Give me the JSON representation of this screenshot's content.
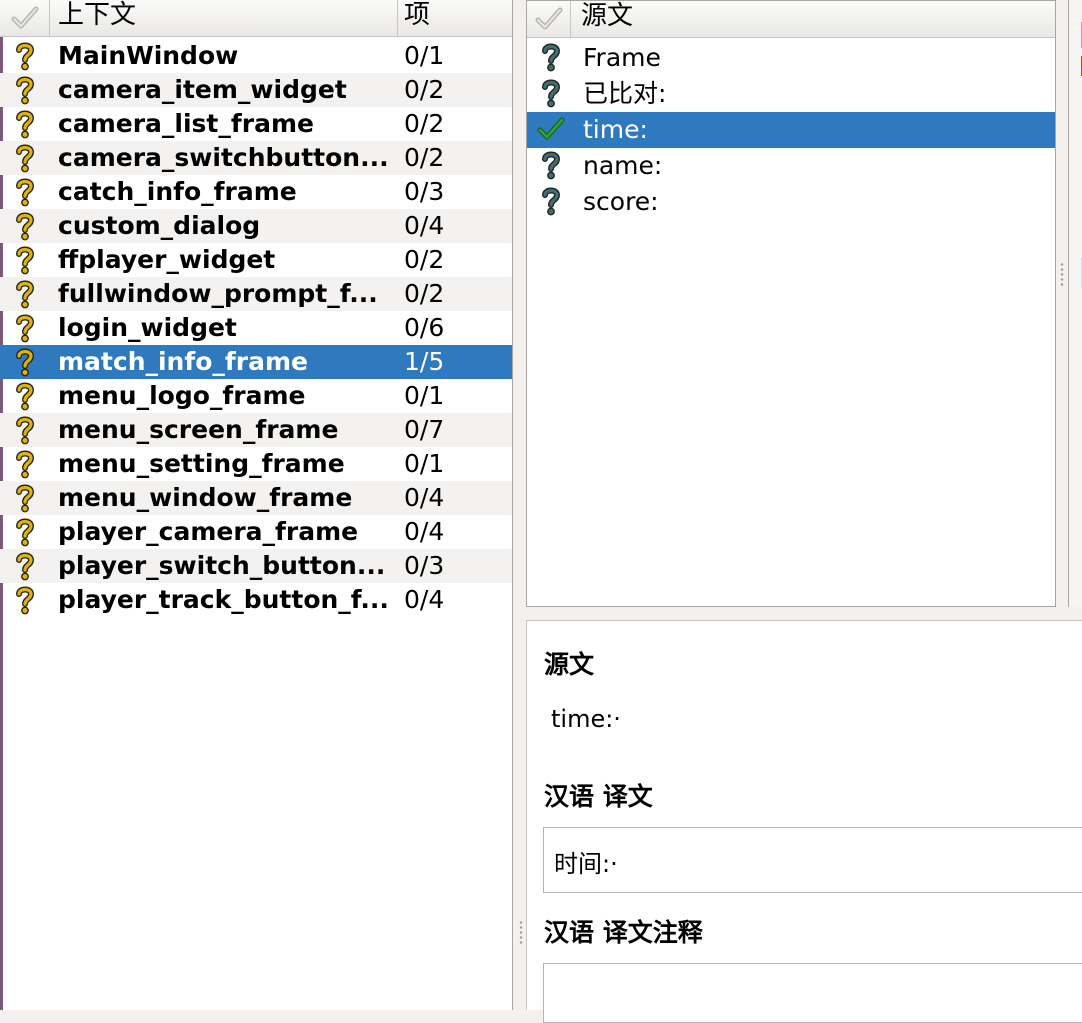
{
  "context_pane": {
    "header": {
      "context_label": "上下文",
      "items_label": "项"
    },
    "rows": [
      {
        "name": "MainWindow",
        "count": "0/1"
      },
      {
        "name": "camera_item_widget",
        "count": "0/2"
      },
      {
        "name": "camera_list_frame",
        "count": "0/2"
      },
      {
        "name": "camera_switchbutton...",
        "count": "0/2"
      },
      {
        "name": "catch_info_frame",
        "count": "0/3"
      },
      {
        "name": "custom_dialog",
        "count": "0/4"
      },
      {
        "name": "ffplayer_widget",
        "count": "0/2"
      },
      {
        "name": "fullwindow_prompt_f...",
        "count": "0/2"
      },
      {
        "name": "login_widget",
        "count": "0/6"
      },
      {
        "name": "match_info_frame",
        "count": "1/5",
        "selected": true
      },
      {
        "name": "menu_logo_frame",
        "count": "0/1"
      },
      {
        "name": "menu_screen_frame",
        "count": "0/7"
      },
      {
        "name": "menu_setting_frame",
        "count": "0/1"
      },
      {
        "name": "menu_window_frame",
        "count": "0/4"
      },
      {
        "name": "player_camera_frame",
        "count": "0/4"
      },
      {
        "name": "player_switch_button...",
        "count": "0/3"
      },
      {
        "name": "player_track_button_f...",
        "count": "0/4"
      }
    ]
  },
  "source_pane": {
    "header": {
      "source_label": "源文"
    },
    "rows": [
      {
        "text": "Frame",
        "status": "question-icon"
      },
      {
        "text": "已比对:",
        "status": "question-icon"
      },
      {
        "text": "time:",
        "status": "check-icon",
        "selected": true
      },
      {
        "text": "name:",
        "status": "question-icon"
      },
      {
        "text": "score:",
        "status": "question-icon"
      }
    ]
  },
  "editor": {
    "source_title": "源文",
    "source_text": "time:·",
    "translation_title": "汉语 译文",
    "translation_text": "时间:·",
    "comment_title": "汉语 译文注释",
    "comment_text": ""
  },
  "colors": {
    "selection": "#2f7abf",
    "question_icon_context": "#e2b400",
    "question_icon_source": "#3f6f72",
    "check_icon": "#2fa52f"
  }
}
